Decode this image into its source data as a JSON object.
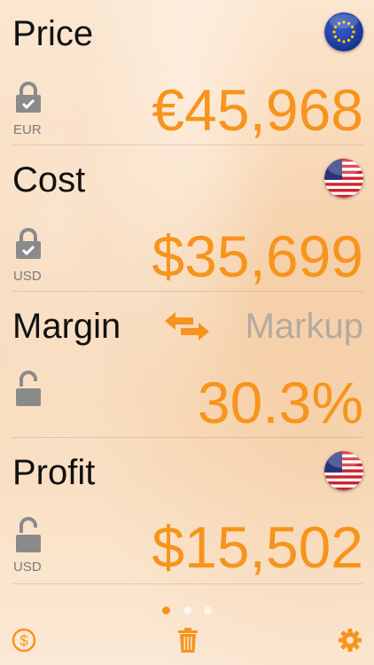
{
  "price": {
    "title": "Price",
    "value": "€45,968",
    "currency": "EUR"
  },
  "cost": {
    "title": "Cost",
    "value": "$35,699",
    "currency": "USD"
  },
  "margin": {
    "title": "Margin",
    "alt_label": "Markup",
    "value": "30.3%"
  },
  "profit": {
    "title": "Profit",
    "value": "$15,502",
    "currency": "USD"
  },
  "pager": {
    "count": 3,
    "active": 0
  },
  "colors": {
    "accent": "#f7941d",
    "muted": "#b3aaa0",
    "lock": "#8a8a8a"
  },
  "icons": [
    "eu-flag-icon",
    "us-flag-icon",
    "lock-closed-icon",
    "lock-open-icon",
    "swap-arrows-icon",
    "dollar-coin-icon",
    "trash-icon",
    "gear-icon"
  ]
}
